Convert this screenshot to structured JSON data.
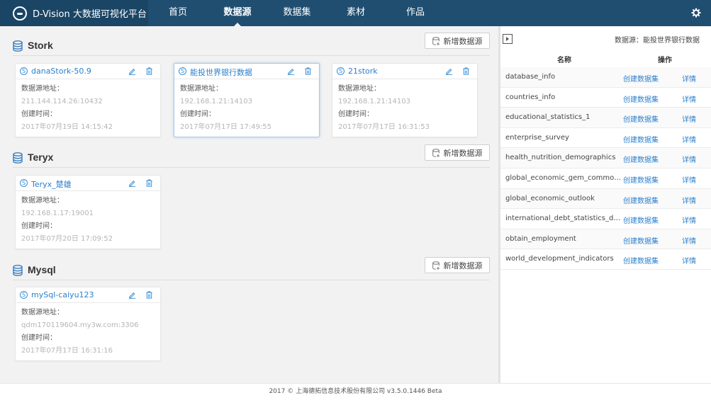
{
  "brand": {
    "title": "D-Vision 大数据可视化平台"
  },
  "nav": {
    "items": [
      {
        "label": "首页"
      },
      {
        "label": "数据源"
      },
      {
        "label": "数据集"
      },
      {
        "label": "素材"
      },
      {
        "label": "作品"
      }
    ],
    "active": "数据源"
  },
  "common": {
    "add_label": "新增数据源",
    "address_label": "数据源地址：",
    "created_label": "创建时间："
  },
  "sections": [
    {
      "title": "Stork",
      "cards": [
        {
          "name": "danaStork-50.9",
          "address": "211.144.114.26:10432",
          "created": "2017年07月19日 14:15:42"
        },
        {
          "name": "能投世界银行数据",
          "address": "192.168.1.21:14103",
          "created": "2017年07月17日 17:49:55"
        },
        {
          "name": "21stork",
          "address": "192.168.1.21:14103",
          "created": "2017年07月17日 16:31:53"
        }
      ]
    },
    {
      "title": "Teryx",
      "cards": [
        {
          "name": "Teryx_楚雄",
          "address": "192.168.1.17:19001",
          "created": "2017年07月20日 17:09:52"
        }
      ]
    },
    {
      "title": "Mysql",
      "cards": [
        {
          "name": "mySql-caiyu123",
          "address": "qdm170119604.my3w.com:3306",
          "created": "2017年07月17日 16:31:16"
        }
      ]
    }
  ],
  "right_panel": {
    "title": "数据源：能投世界银行数据",
    "header_name": "名称",
    "header_op": "操作",
    "create_label": "创建数据集",
    "detail_label": "详情",
    "rows": [
      "database_info",
      "countries_info",
      "educational_statistics_1",
      "enterprise_survey",
      "health_nutrition_demographics",
      "global_economic_gem_commodity...",
      "global_economic_outlook",
      "international_debt_statistics_datab...",
      "obtain_employment",
      "world_development_indicators"
    ]
  },
  "footer": {
    "text": "2017 © 上海德拓信息技术股份有限公司 v3.5.0.1446 Beta"
  },
  "colors": {
    "nav_bg": "#1f4e70",
    "accent": "#2a7fcc"
  }
}
